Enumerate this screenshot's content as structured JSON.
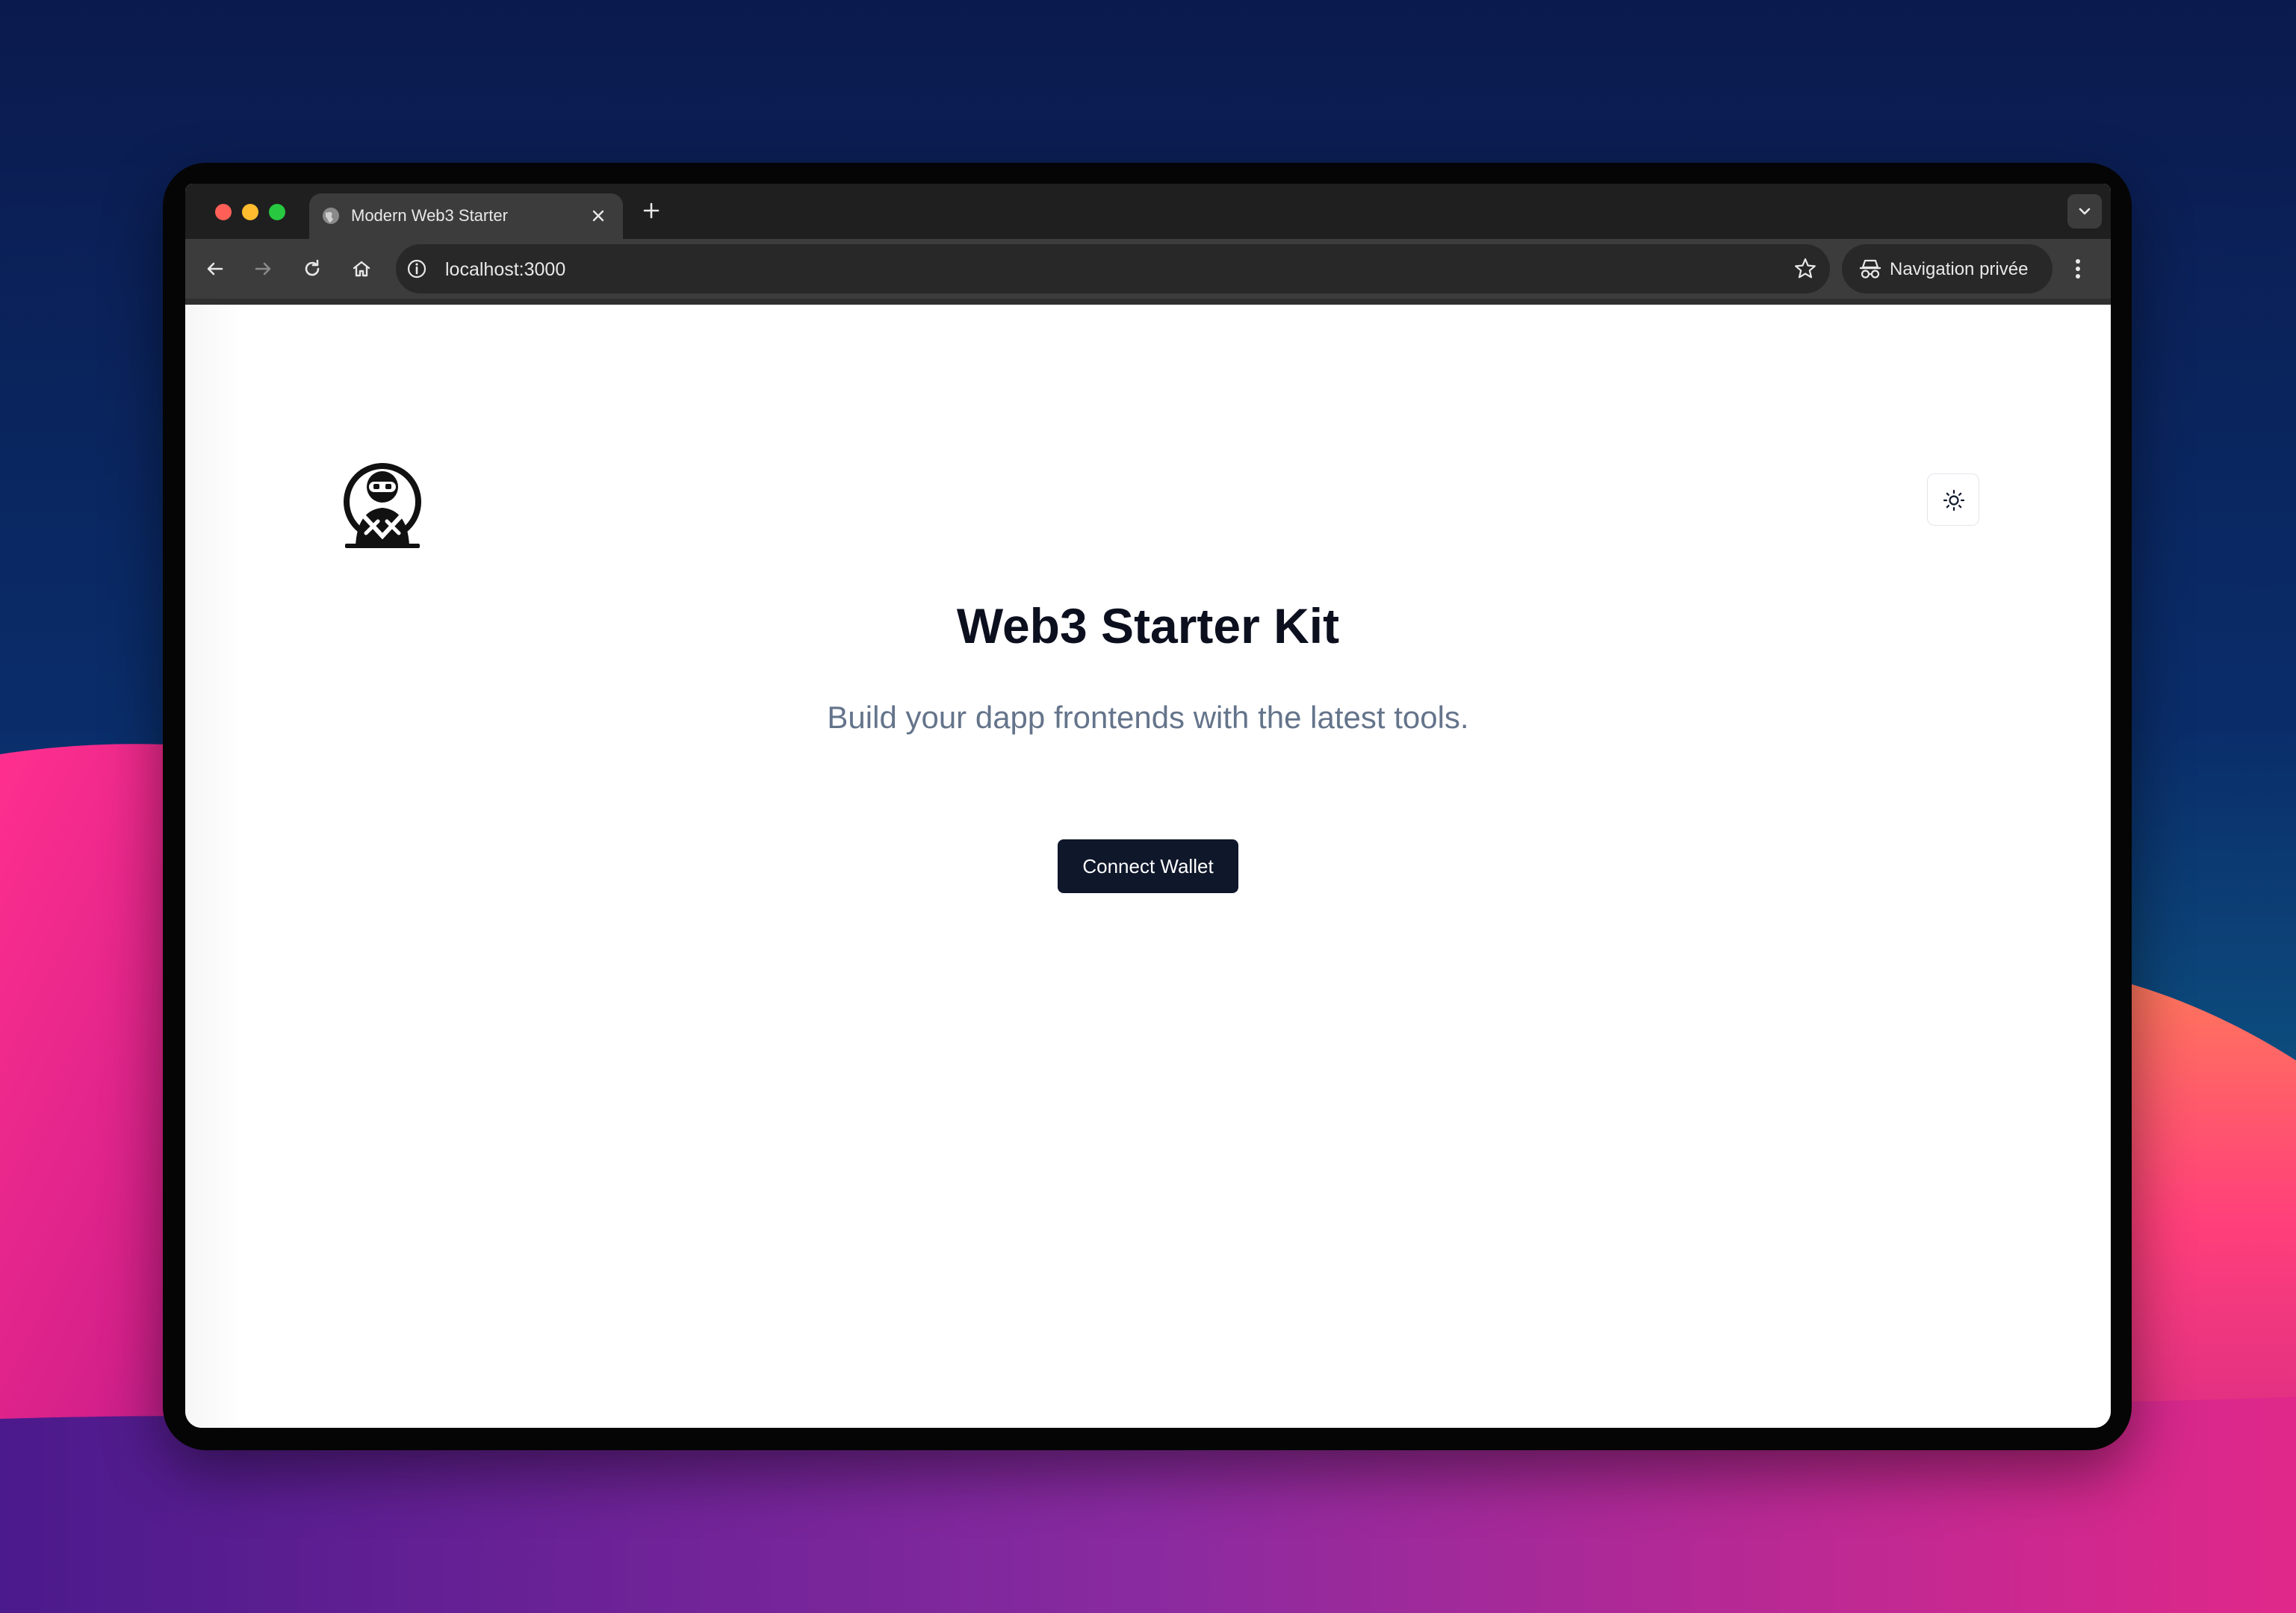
{
  "browser": {
    "tab": {
      "title": "Modern Web3 Starter",
      "favicon": "globe-icon"
    },
    "address_bar": {
      "url": "localhost:3000"
    },
    "profile": {
      "label": "Navigation privée",
      "icon": "incognito-icon"
    },
    "icons": [
      "back-arrow-icon",
      "forward-arrow-icon",
      "reload-icon",
      "home-icon",
      "info-icon",
      "star-icon",
      "more-menu-icon",
      "chevron-down-icon",
      "plus-icon",
      "close-icon"
    ]
  },
  "page": {
    "title": "Web3 Starter Kit",
    "subtitle": "Build your dapp frontends with the latest tools.",
    "connect_button": "Connect Wallet",
    "logo": "ninja-logo",
    "theme_toggle_icon": "sun-icon"
  },
  "colors": {
    "button_bg": "#0f172a",
    "title": "#0b0f1e",
    "subtitle": "#64748b",
    "chrome_dark": "#1f1f1f",
    "chrome_toolbar": "#3c3c3c"
  }
}
